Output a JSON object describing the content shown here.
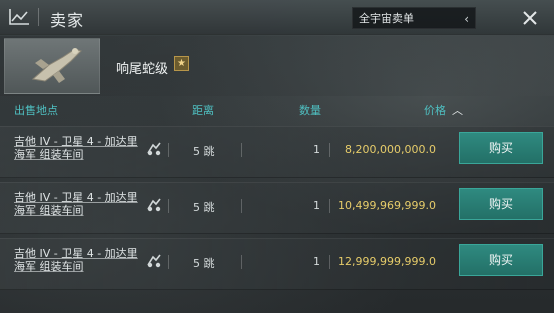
{
  "window": {
    "title": "卖家",
    "scope_select_value": "全宇宙卖单",
    "icons": {
      "title": "chart-line-icon",
      "close": "close-icon",
      "chevron": "chevron-left-icon"
    }
  },
  "item": {
    "name": "响尾蛇级",
    "badge_glyph": "★",
    "thumbnail_icon": "ship-thumbnail-icon"
  },
  "columns": {
    "location": "出售地点",
    "distance": "距离",
    "quantity": "数量",
    "price": "价格"
  },
  "rows": [
    {
      "location": "吉他 IV - 卫星 4 - 加达里海军 组装车间",
      "jumps": "5 跳",
      "quantity": "1",
      "price": "8,200,000,000.0",
      "action": "购买"
    },
    {
      "location": "吉他 IV - 卫星 4 - 加达里海军 组装车间",
      "jumps": "5 跳",
      "quantity": "1",
      "price": "10,499,969,999.0",
      "action": "购买"
    },
    {
      "location": "吉他 IV - 卫星 4 - 加达里海军 组装车间",
      "jumps": "5 跳",
      "quantity": "1",
      "price": "12,999,999,999.0",
      "action": "购买"
    }
  ],
  "colors": {
    "accent_teal": "#2f8a80",
    "column_header": "#4fc0c2",
    "price_gold": "#e6cc6a"
  }
}
